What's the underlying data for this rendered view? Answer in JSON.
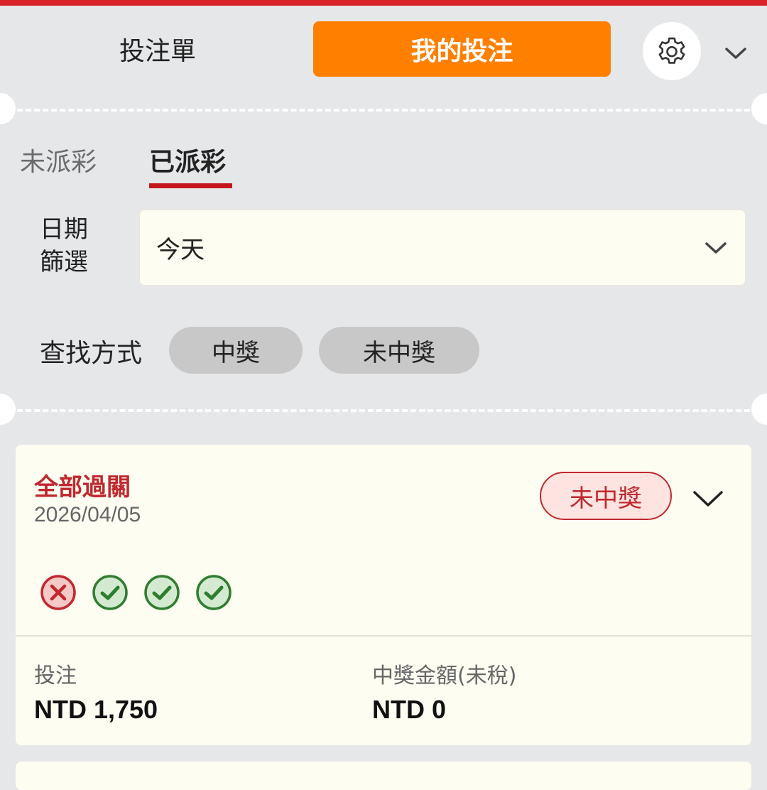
{
  "header": {
    "betslip_tab": "投注單",
    "mybets_tab": "我的投注",
    "settings_icon": "gear-icon",
    "expand_icon": "chevron-down-icon"
  },
  "subtabs": {
    "unsettled": "未派彩",
    "settled": "已派彩"
  },
  "filters": {
    "date_label": "日期篩選",
    "date_value": "今天",
    "search_label": "查找方式",
    "win_pill": "中獎",
    "lose_pill": "未中獎"
  },
  "bet_card": {
    "title": "全部過關",
    "date": "2026/04/05",
    "status": "未中獎",
    "results": [
      "loss",
      "win",
      "win",
      "win"
    ],
    "stake_label": "投注",
    "stake_value": "NTD 1,750",
    "payout_label": "中獎金額(未稅)",
    "payout_value": "NTD 0"
  },
  "colors": {
    "top_bar": "#d7222a",
    "accent_orange": "#ff7f00",
    "status_red": "#c0282e",
    "win_green": "#2f7d2f",
    "background": "#e6e7e9",
    "card_bg": "#fefdf2"
  }
}
